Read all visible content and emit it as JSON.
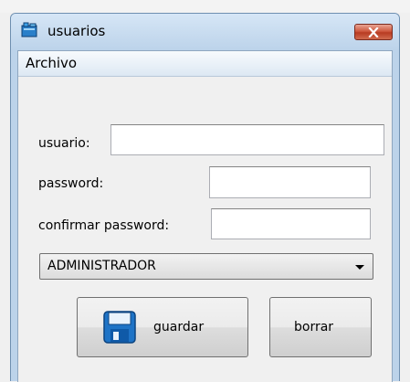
{
  "window": {
    "title": "usuarios"
  },
  "menu": {
    "items": [
      "Archivo"
    ]
  },
  "form": {
    "usuario_label": "usuario:",
    "usuario_value": "",
    "password_label": "password:",
    "password_value": "",
    "confirm_label": "confirmar password:",
    "confirm_value": "",
    "role_selected": "ADMINISTRADOR"
  },
  "buttons": {
    "save_label": "guardar",
    "clear_label": "borrar"
  },
  "colors": {
    "title_bar": "#bcd3ea",
    "close_button": "#c94a30",
    "save_icon": "#1e73c6"
  }
}
